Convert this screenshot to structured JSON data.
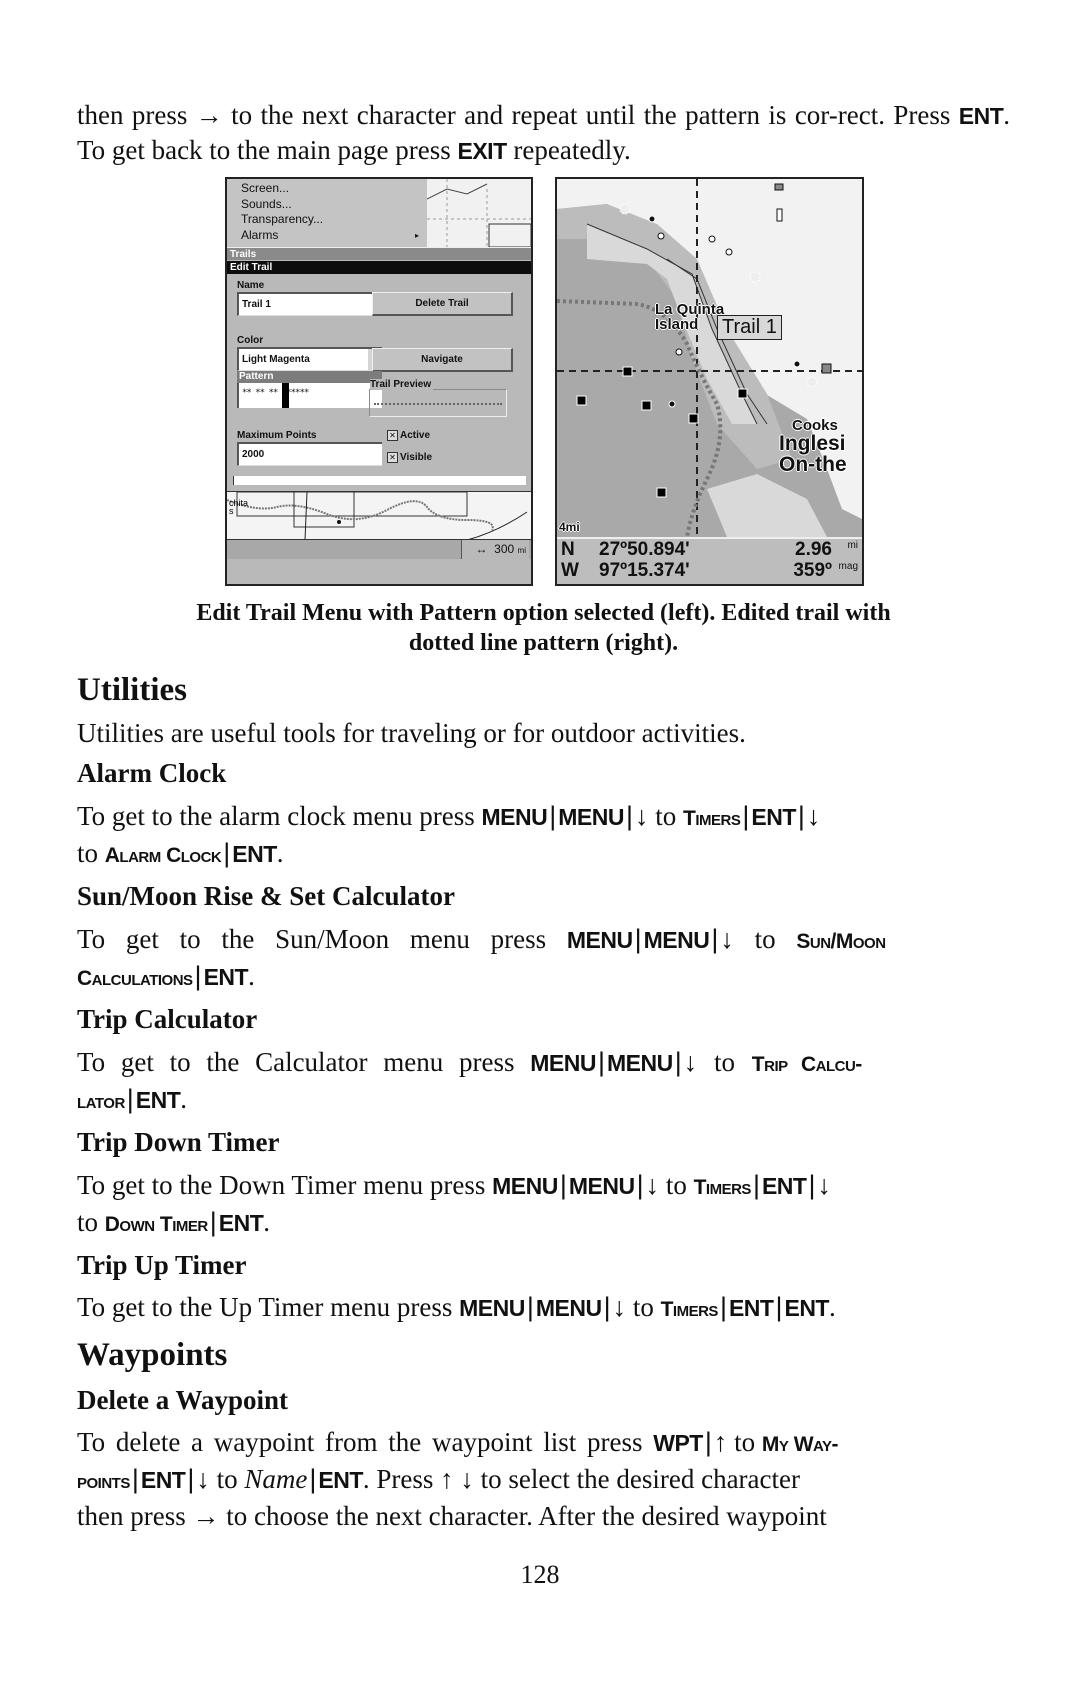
{
  "intro": {
    "line1_before_arrow": "then press ",
    "arrow_right": "→",
    "line1_after_arrow": " to the next character and repeat until the pattern is cor-rect. Press ",
    "key_ent": "ENT",
    "mid": ". To get back to the main page press ",
    "key_exit": "EXIT",
    "end": " repeatedly."
  },
  "figure_left": {
    "menu_items": [
      "Screen...",
      "Sounds...",
      "Transparency...",
      "Alarms"
    ],
    "alarms_submenu_arrow": "▸",
    "trails_bar": "Trails",
    "edit_trail_bar": "Edit Trail",
    "name_label": "Name",
    "name_value": "Trail 1",
    "delete_trail_button": "Delete Trail",
    "color_label": "Color",
    "color_value": "Light Magenta",
    "dropdown_arrow": "▼",
    "navigate_button": "Navigate",
    "pattern_label": "Pattern",
    "pattern_value": "** ** **  ******",
    "trail_preview_label": "Trail Preview",
    "max_points_label": "Maximum Points",
    "max_points_value": "2000",
    "active_label": "Active",
    "active_checked": true,
    "visible_label": "Visible",
    "visible_checked": true,
    "check_mark": "✕",
    "map_place_fragment": "chita\ns",
    "scale_icon": "↔",
    "scale_value": "300",
    "scale_unit": "mi"
  },
  "figure_right": {
    "place_la_quinta": "La Quinta",
    "place_island": "Island",
    "trail_label": "Trail 1",
    "place_cooks": "Cooks",
    "place_inglesi": "Inglesi",
    "place_onthe": "On-the",
    "zoom_scale": "4mi",
    "lat_dir": "N",
    "lat_value": "27º50.894'",
    "lon_dir": "W",
    "lon_value": "97º15.374'",
    "distance_value": "2.96",
    "distance_unit": "mi",
    "bearing_value": "359º",
    "bearing_unit": "mag"
  },
  "caption": {
    "line1": "Edit Trail Menu with Pattern option selected (left). Edited trail with",
    "line2": "dotted line pattern (right)."
  },
  "utilities": {
    "heading": "Utilities",
    "intro": "Utilities are useful tools for traveling or for outdoor activities.",
    "alarm_clock": {
      "heading": "Alarm Clock",
      "text_a": "To get to the alarm clock menu press ",
      "k1": "MENU",
      "k2": "MENU",
      "down": "↓",
      "to": " to ",
      "sc1": "Timers",
      "k3": "ENT",
      "text_b": "to ",
      "sc2": "Alarm Clock",
      "k4": "ENT",
      "period": "."
    },
    "sun_moon": {
      "heading": "Sun/Moon Rise & Set Calculator",
      "text_a": "To get to the Sun/Moon menu press ",
      "k1": "MENU",
      "k2": "MENU",
      "down": "↓",
      "to": " to ",
      "sc1": "Sun/Moon",
      "sc2": "Calculations",
      "k3": "ENT",
      "period": "."
    },
    "trip_calc": {
      "heading": "Trip Calculator",
      "text_a": "To get to the Calculator menu press ",
      "k1": "MENU",
      "k2": "MENU",
      "down": "↓",
      "to": " to ",
      "sc1": "Trip Calcu-",
      "sc2": "lator",
      "k3": "ENT",
      "period": "."
    },
    "down_timer": {
      "heading": "Trip Down Timer",
      "text_a": "To get to the Down Timer menu press ",
      "k1": "MENU",
      "k2": "MENU",
      "down": "↓",
      "to": " to ",
      "sc1": "Timers",
      "k3": "ENT",
      "text_b": "to ",
      "sc2": "Down Timer",
      "k4": "ENT",
      "period": "."
    },
    "up_timer": {
      "heading": "Trip Up Timer",
      "text_a": "To get to the Up Timer menu press ",
      "k1": "MENU",
      "k2": "MENU",
      "down": "↓",
      "to": " to ",
      "sc1": "Timers",
      "k3": "ENT",
      "k4": "ENT",
      "period": "."
    }
  },
  "waypoints": {
    "heading": "Waypoints",
    "delete": {
      "heading": "Delete a Waypoint",
      "text_a": "To delete a waypoint from the waypoint list press ",
      "k1": "WPT",
      "up": "↑",
      "to": " to ",
      "sc1": "My Way-",
      "sc2": "points",
      "k2": "ENT",
      "down": "↓",
      "to2": " to ",
      "name_it": "Name",
      "k3": "ENT",
      "text_b": ". Press ",
      "updown": "↑ ↓",
      "text_c": " to select the desired character",
      "text_d": "then press ",
      "right": "→",
      "text_e": " to  choose the next character. After the desired waypoint"
    }
  },
  "page_number": "128"
}
